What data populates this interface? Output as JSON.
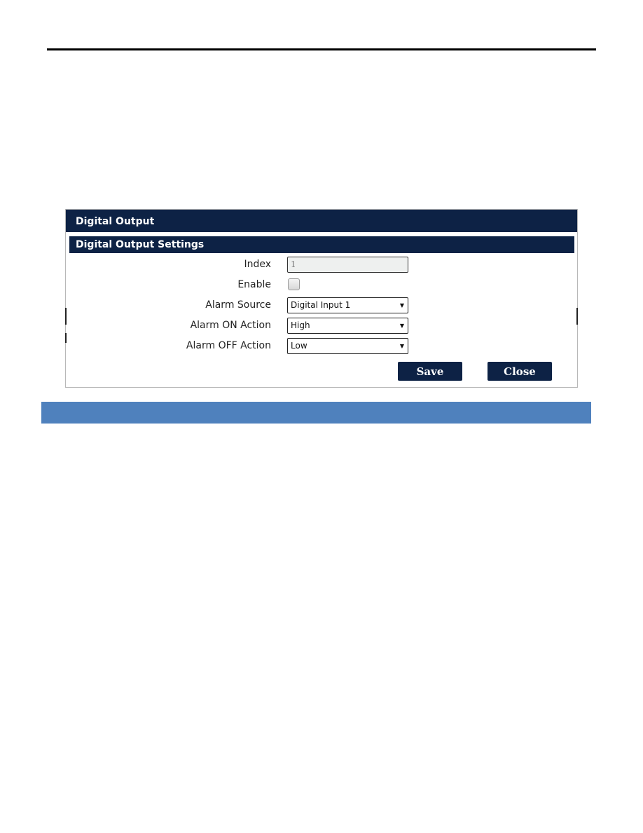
{
  "dialog": {
    "title": "Digital Output",
    "section_title": "Digital Output Settings",
    "fields": {
      "index": {
        "label": "Index",
        "value": "1"
      },
      "enable": {
        "label": "Enable",
        "checked": false
      },
      "alarm_source": {
        "label": "Alarm Source",
        "value": "Digital Input 1"
      },
      "alarm_on_action": {
        "label": "Alarm ON Action",
        "value": "High"
      },
      "alarm_off_action": {
        "label": "Alarm OFF Action",
        "value": "Low"
      }
    },
    "buttons": {
      "save": "Save",
      "close": "Close"
    },
    "dropdown_arrow": "▼"
  },
  "colors": {
    "header_bg": "#0d2245",
    "section_bar": "#4f81bd"
  }
}
